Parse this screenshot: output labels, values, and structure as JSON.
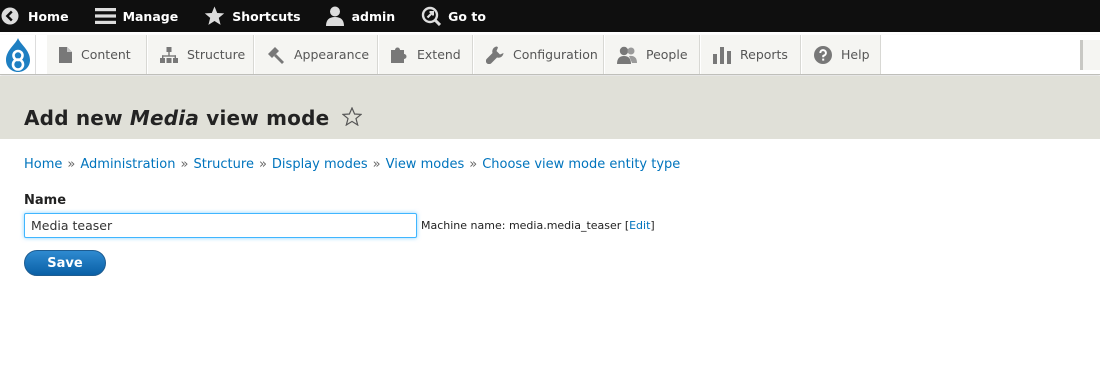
{
  "toolbar": {
    "home": "Home",
    "manage": "Manage",
    "shortcuts": "Shortcuts",
    "user": "admin",
    "goto": "Go to"
  },
  "tray": {
    "items": [
      {
        "label": "Content",
        "icon": "content-icon"
      },
      {
        "label": "Structure",
        "icon": "structure-icon"
      },
      {
        "label": "Appearance",
        "icon": "appearance-icon"
      },
      {
        "label": "Extend",
        "icon": "extend-icon"
      },
      {
        "label": "Configuration",
        "icon": "configuration-icon"
      },
      {
        "label": "People",
        "icon": "people-icon"
      },
      {
        "label": "Reports",
        "icon": "reports-icon"
      },
      {
        "label": "Help",
        "icon": "help-icon"
      }
    ]
  },
  "page": {
    "title_before": "Add new ",
    "title_entity": "Media",
    "title_after": " view mode"
  },
  "breadcrumb": [
    "Home",
    "Administration",
    "Structure",
    "Display modes",
    "View modes",
    "Choose view mode entity type"
  ],
  "breadcrumb_separator": "»",
  "form": {
    "name_label": "Name",
    "name_value": "Media teaser",
    "machine_label": "Machine name: media.media_teaser",
    "machine_bracket_open": "[",
    "machine_edit": "Edit",
    "machine_bracket_close": "]",
    "save_label": "Save"
  },
  "colors": {
    "link": "#0074bd",
    "toolbar_bg": "#0f0f0f",
    "header_bg": "#e0e0d8",
    "button": "#0a60a6"
  }
}
